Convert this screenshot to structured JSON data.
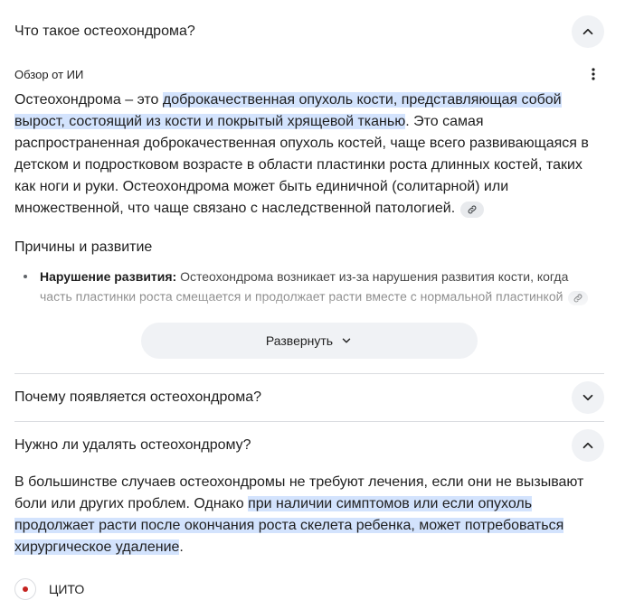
{
  "question1": {
    "title": "Что такое остеохондрома?",
    "expanded": true
  },
  "ai_overview": {
    "label": "Обзор от ИИ",
    "para_start": "Остеохондрома – это ",
    "para_highlight": "доброкачественная опухоль кости, представляющая собой вырост, состоящий из кости и покрытый хрящевой тканью",
    "para_end": ". Это самая распространенная доброкачественная опухоль костей, чаще всего развивающаяся в детском и подростковом возрасте в области пластинки роста длинных костей, таких как ноги и руки. Остеохондрома может быть единичной (солитарной) или множественной, что чаще связано с наследственной патологией."
  },
  "causes": {
    "heading": "Причины и развитие",
    "bullets": [
      {
        "term": "Нарушение развития:",
        "text": " Остеохондрома возникает из-за нарушения развития кости, когда часть пластинки роста смещается и продолжает расти вместе с нормальной пластинкой"
      }
    ]
  },
  "expand_button": {
    "label": "Развернуть"
  },
  "question2": {
    "title": "Почему появляется остеохондрома?",
    "expanded": false
  },
  "question3": {
    "title": "Нужно ли удалять остеохондрому?",
    "expanded": true,
    "para_start": "В большинстве случаев остеохондромы не требуют лечения, если они не вызывают боли или других проблем. Однако ",
    "para_highlight": "при наличии симптомов или если опухоль продолжает расти после окончания роста скелета ребенка, может потребоваться хирургическое удаление",
    "para_end": "."
  },
  "source": {
    "name": "ЦИТО"
  },
  "icons": {
    "collapse": "chevron-up-icon",
    "expand": "chevron-down-icon",
    "more": "more-vert-icon",
    "link": "link-icon"
  }
}
